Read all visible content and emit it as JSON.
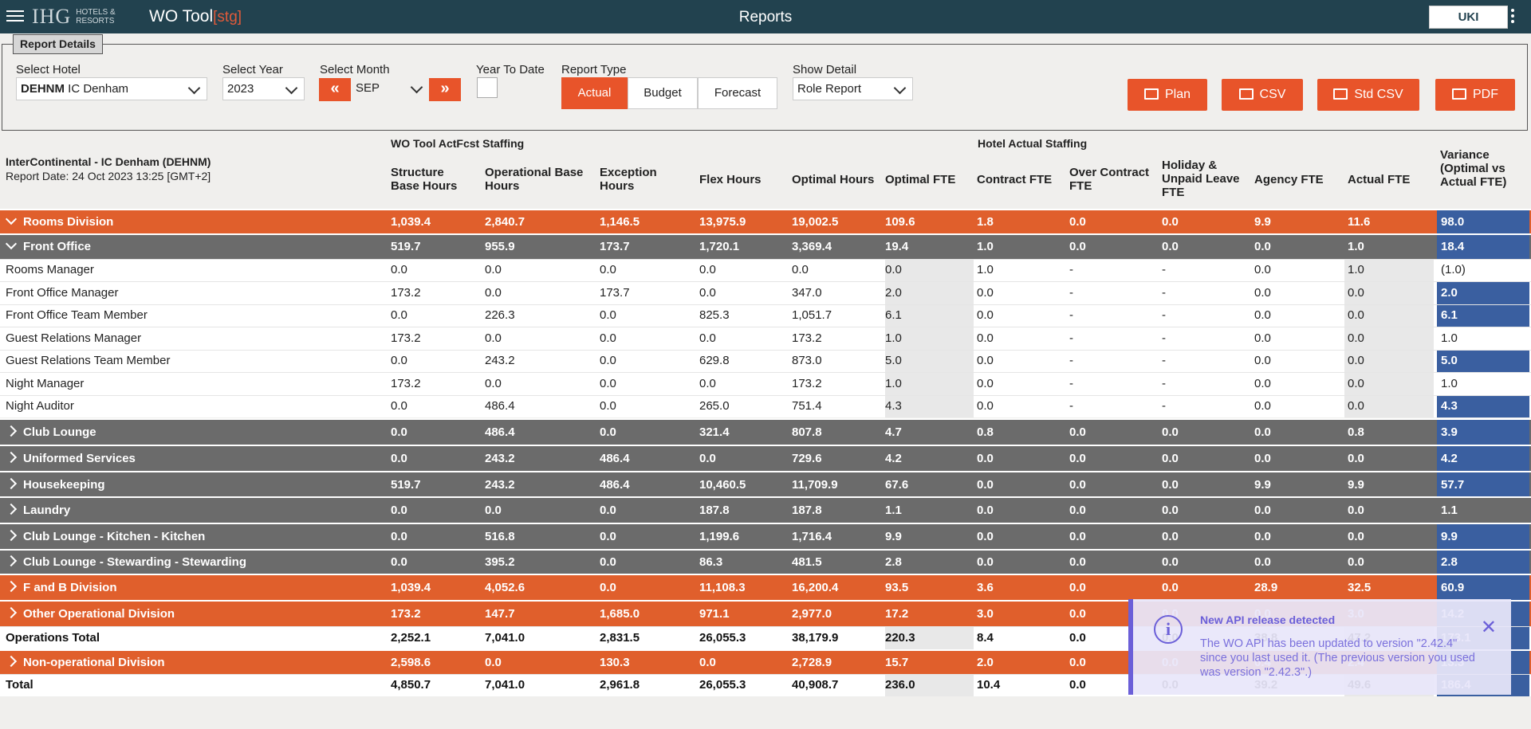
{
  "topbar": {
    "logo_main": "IHG",
    "logo_sub1": "HOTELS &",
    "logo_sub2": "RESORTS",
    "app_title": "WO Tool",
    "app_env": "[stg]",
    "page_title": "Reports",
    "region_button": "UKI"
  },
  "report_details": {
    "legend": "Report Details",
    "hotel": {
      "label": "Select Hotel",
      "code": "DEHNM",
      "name": "IC Denham"
    },
    "year": {
      "label": "Select Year",
      "value": "2023"
    },
    "month": {
      "label": "Select Month",
      "value": "SEP",
      "prev": "«",
      "next": "»"
    },
    "ytd": {
      "label": "Year To Date",
      "checked": false
    },
    "report_type": {
      "label": "Report Type",
      "options": [
        "Actual",
        "Budget",
        "Forecast"
      ],
      "selected": "Actual"
    },
    "show_detail": {
      "label": "Show Detail",
      "value": "Role Report"
    },
    "buttons": [
      "Plan",
      "CSV",
      "Std CSV",
      "PDF"
    ]
  },
  "report_info": {
    "title": "InterContinental - IC Denham (DEHNM)",
    "date": "Report Date: 24 Oct 2023 13:25 [GMT+2]"
  },
  "group_headers": {
    "wo": "WO Tool ActFcst Staffing",
    "hotel": "Hotel Actual Staffing"
  },
  "columns": [
    [
      "Structure",
      "Base Hours"
    ],
    [
      "Operational Base",
      "Hours"
    ],
    [
      "Exception",
      "Hours"
    ],
    [
      "Flex Hours"
    ],
    [
      "Optimal Hours"
    ],
    [
      "Optimal FTE"
    ],
    [
      "Contract FTE"
    ],
    [
      "Over Contract",
      "FTE"
    ],
    [
      "Holiday &",
      "Unpaid Leave",
      "FTE"
    ],
    [
      "Agency FTE"
    ],
    [
      "Actual FTE"
    ],
    [
      "Variance",
      "(Optimal vs",
      "Actual FTE)"
    ]
  ],
  "rows": [
    {
      "type": "div",
      "tw": "down",
      "name": "Rooms Division",
      "values": [
        "1,039.4",
        "2,840.7",
        "1,146.5",
        "13,975.9",
        "19,002.5",
        "109.6",
        "1.8",
        "0.0",
        "0.0",
        "9.9",
        "11.6",
        "98.0"
      ],
      "blue": true
    },
    {
      "type": "dept",
      "tw": "down",
      "name": "Front Office",
      "values": [
        "519.7",
        "955.9",
        "173.7",
        "1,720.1",
        "3,369.4",
        "19.4",
        "1.0",
        "0.0",
        "0.0",
        "0.0",
        "1.0",
        "18.4"
      ],
      "blue": true
    },
    {
      "type": "role",
      "name": "Rooms Manager",
      "values": [
        "0.0",
        "0.0",
        "0.0",
        "0.0",
        "0.0",
        "0.0",
        "1.0",
        "-",
        "-",
        "0.0",
        "1.0",
        "(1.0)"
      ],
      "blue": false
    },
    {
      "type": "role",
      "name": "Front Office Manager",
      "values": [
        "173.2",
        "0.0",
        "173.7",
        "0.0",
        "347.0",
        "2.0",
        "0.0",
        "-",
        "-",
        "0.0",
        "0.0",
        "2.0"
      ],
      "blue": true
    },
    {
      "type": "role",
      "name": "Front Office Team Member",
      "values": [
        "0.0",
        "226.3",
        "0.0",
        "825.3",
        "1,051.7",
        "6.1",
        "0.0",
        "-",
        "-",
        "0.0",
        "0.0",
        "6.1"
      ],
      "blue": true
    },
    {
      "type": "role",
      "name": "Guest Relations Manager",
      "values": [
        "173.2",
        "0.0",
        "0.0",
        "0.0",
        "173.2",
        "1.0",
        "0.0",
        "-",
        "-",
        "0.0",
        "0.0",
        "1.0"
      ],
      "blue": false
    },
    {
      "type": "role",
      "name": "Guest Relations Team Member",
      "values": [
        "0.0",
        "243.2",
        "0.0",
        "629.8",
        "873.0",
        "5.0",
        "0.0",
        "-",
        "-",
        "0.0",
        "0.0",
        "5.0"
      ],
      "blue": true
    },
    {
      "type": "role",
      "name": "Night Manager",
      "values": [
        "173.2",
        "0.0",
        "0.0",
        "0.0",
        "173.2",
        "1.0",
        "0.0",
        "-",
        "-",
        "0.0",
        "0.0",
        "1.0"
      ],
      "blue": false
    },
    {
      "type": "role",
      "name": "Night Auditor",
      "values": [
        "0.0",
        "486.4",
        "0.0",
        "265.0",
        "751.4",
        "4.3",
        "0.0",
        "-",
        "-",
        "0.0",
        "0.0",
        "4.3"
      ],
      "blue": true
    },
    {
      "type": "dept",
      "tw": "right",
      "name": "Club Lounge",
      "values": [
        "0.0",
        "486.4",
        "0.0",
        "321.4",
        "807.8",
        "4.7",
        "0.8",
        "0.0",
        "0.0",
        "0.0",
        "0.8",
        "3.9"
      ],
      "blue": true
    },
    {
      "type": "dept",
      "tw": "right",
      "name": "Uniformed Services",
      "values": [
        "0.0",
        "243.2",
        "486.4",
        "0.0",
        "729.6",
        "4.2",
        "0.0",
        "0.0",
        "0.0",
        "0.0",
        "0.0",
        "4.2"
      ],
      "blue": true
    },
    {
      "type": "dept",
      "tw": "right",
      "name": "Housekeeping",
      "values": [
        "519.7",
        "243.2",
        "486.4",
        "10,460.5",
        "11,709.9",
        "67.6",
        "0.0",
        "0.0",
        "0.0",
        "9.9",
        "9.9",
        "57.7"
      ],
      "blue": true
    },
    {
      "type": "dept",
      "tw": "right",
      "name": "Laundry",
      "values": [
        "0.0",
        "0.0",
        "0.0",
        "187.8",
        "187.8",
        "1.1",
        "0.0",
        "0.0",
        "0.0",
        "0.0",
        "0.0",
        "1.1"
      ],
      "blue": false
    },
    {
      "type": "dept",
      "tw": "right",
      "name": "Club Lounge - Kitchen - Kitchen",
      "values": [
        "0.0",
        "516.8",
        "0.0",
        "1,199.6",
        "1,716.4",
        "9.9",
        "0.0",
        "0.0",
        "0.0",
        "0.0",
        "0.0",
        "9.9"
      ],
      "blue": true
    },
    {
      "type": "dept",
      "tw": "right",
      "name": "Club Lounge - Stewarding - Stewarding",
      "values": [
        "0.0",
        "395.2",
        "0.0",
        "86.3",
        "481.5",
        "2.8",
        "0.0",
        "0.0",
        "0.0",
        "0.0",
        "0.0",
        "2.8"
      ],
      "blue": true
    },
    {
      "type": "div",
      "tw": "right",
      "name": "F and B Division",
      "values": [
        "1,039.4",
        "4,052.6",
        "0.0",
        "11,108.3",
        "16,200.4",
        "93.5",
        "3.6",
        "0.0",
        "0.0",
        "28.9",
        "32.5",
        "60.9"
      ],
      "blue": true
    },
    {
      "type": "div",
      "tw": "right",
      "name": "Other Operational Division",
      "values": [
        "173.2",
        "147.7",
        "1,685.0",
        "971.1",
        "2,977.0",
        "17.2",
        "3.0",
        "0.0",
        "0.0",
        "0.0",
        "3.0",
        "14.2"
      ],
      "blue": true
    },
    {
      "type": "tot",
      "name": "Operations Total",
      "values": [
        "2,252.1",
        "7,041.0",
        "2,831.5",
        "26,055.3",
        "38,179.9",
        "220.3",
        "8.4",
        "0.0",
        "0.0",
        "38.8",
        "47.2",
        "173.1"
      ],
      "blue": true
    },
    {
      "type": "div",
      "tw": "right",
      "name": "Non-operational Division",
      "values": [
        "2,598.6",
        "0.0",
        "130.3",
        "0.0",
        "2,728.9",
        "15.7",
        "2.0",
        "0.0",
        "0.0",
        "0.4",
        "2.4",
        "13.3"
      ],
      "blue": true
    },
    {
      "type": "tot",
      "name": "Total",
      "values": [
        "4,850.7",
        "7,041.0",
        "2,961.8",
        "26,055.3",
        "40,908.7",
        "236.0",
        "10.4",
        "0.0",
        "0.0",
        "39.2",
        "49.6",
        "186.4"
      ],
      "blue": true
    }
  ],
  "toast": {
    "title": "New API release detected",
    "body": "The WO API has been updated to version \"2.42.4\" since you last used it. (The previous version you used was version \"2.42.3\".)",
    "icon": "info-icon",
    "close": "close-icon"
  },
  "colors": {
    "topbar": "#22424f",
    "accent": "#e8542a",
    "division": "#e05f2c",
    "department": "#6b6b6b",
    "variance": "#3a5fa0",
    "toast": "#6b5fd8"
  }
}
